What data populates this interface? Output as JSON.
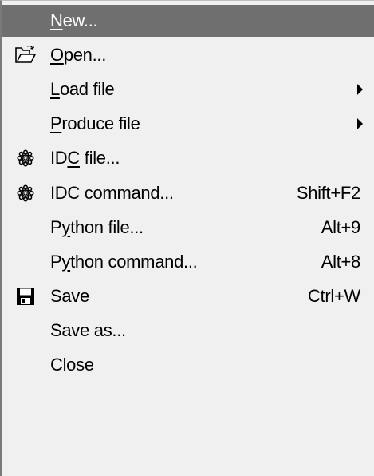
{
  "menu": {
    "items": [
      {
        "id": "new",
        "label": "New...",
        "mnemonic": 0,
        "shortcut": "",
        "submenu": false,
        "icon": "",
        "highlighted": true
      },
      {
        "id": "open",
        "label": "Open...",
        "mnemonic": 0,
        "shortcut": "",
        "submenu": false,
        "icon": "open-folder-icon",
        "highlighted": false
      },
      {
        "id": "load-file",
        "label": "Load file",
        "mnemonic": 0,
        "shortcut": "",
        "submenu": true,
        "icon": "",
        "highlighted": false
      },
      {
        "id": "produce-file",
        "label": "Produce file",
        "mnemonic": 0,
        "shortcut": "",
        "submenu": true,
        "icon": "",
        "highlighted": false
      },
      {
        "id": "idc-file",
        "label": "IDC file...",
        "mnemonic": 2,
        "shortcut": "",
        "submenu": false,
        "icon": "gear-icon",
        "highlighted": false
      },
      {
        "id": "idc-command",
        "label": "IDC command...",
        "mnemonic": -1,
        "shortcut": "Shift+F2",
        "submenu": false,
        "icon": "gear-icon",
        "highlighted": false
      },
      {
        "id": "python-file",
        "label": "Python file...",
        "mnemonic": 1,
        "shortcut": "Alt+9",
        "submenu": false,
        "icon": "",
        "highlighted": false
      },
      {
        "id": "python-command",
        "label": "Python command...",
        "mnemonic": 1,
        "shortcut": "Alt+8",
        "submenu": false,
        "icon": "",
        "highlighted": false
      },
      {
        "id": "save",
        "label": "Save",
        "mnemonic": -1,
        "shortcut": "Ctrl+W",
        "submenu": false,
        "icon": "floppy-disk-icon",
        "highlighted": false
      },
      {
        "id": "save-as",
        "label": "Save as...",
        "mnemonic": -1,
        "shortcut": "",
        "submenu": false,
        "icon": "",
        "highlighted": false
      },
      {
        "id": "close",
        "label": "Close",
        "mnemonic": -1,
        "shortcut": "",
        "submenu": false,
        "icon": "",
        "highlighted": false
      }
    ]
  },
  "colors": {
    "menu_background": "#f0f0f0",
    "highlight_background": "#6f6f6f",
    "highlight_text": "#ffffff",
    "text": "#000000"
  }
}
